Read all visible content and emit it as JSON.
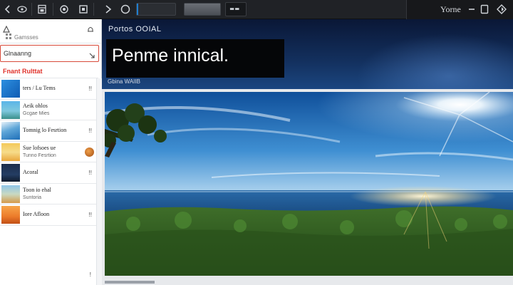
{
  "toolbar": {
    "icons": [
      "back-icon",
      "eye-icon",
      "layout-icon",
      "refresh-icon",
      "crop-icon",
      "play-icon",
      "record-icon"
    ],
    "zoom_fill_fraction": 0.0,
    "right_label": "Yorne",
    "accent": "#1f7fd1"
  },
  "sidebar": {
    "header_sub": "Gamsses",
    "search_value": "Glnaanng",
    "section_title": "Fnant Rulttat",
    "section_color": "#e0322b",
    "items": [
      {
        "label": "ters / Lu Tems",
        "sub": "",
        "mark": "!!"
      },
      {
        "label": "Aeik ohlos",
        "sub": "Gcgae Mies",
        "mark": ""
      },
      {
        "label": "Tomnig lo Fesrtion",
        "sub": "",
        "mark": "!!"
      },
      {
        "label": "Sue lofsoes ue",
        "sub": "Tunno Fesrtion",
        "mark": ""
      },
      {
        "label": "Acoral",
        "sub": "",
        "mark": "!!"
      },
      {
        "label": "Toon io ehal",
        "sub": "Suntoria",
        "mark": ""
      },
      {
        "label": "Iore Afloon",
        "sub": "",
        "mark": "!!"
      }
    ],
    "footer_mark": "!"
  },
  "main": {
    "caption": "Portos OOIAL",
    "headline": "Penme innical.",
    "meta": "Gbina WAIIB"
  }
}
